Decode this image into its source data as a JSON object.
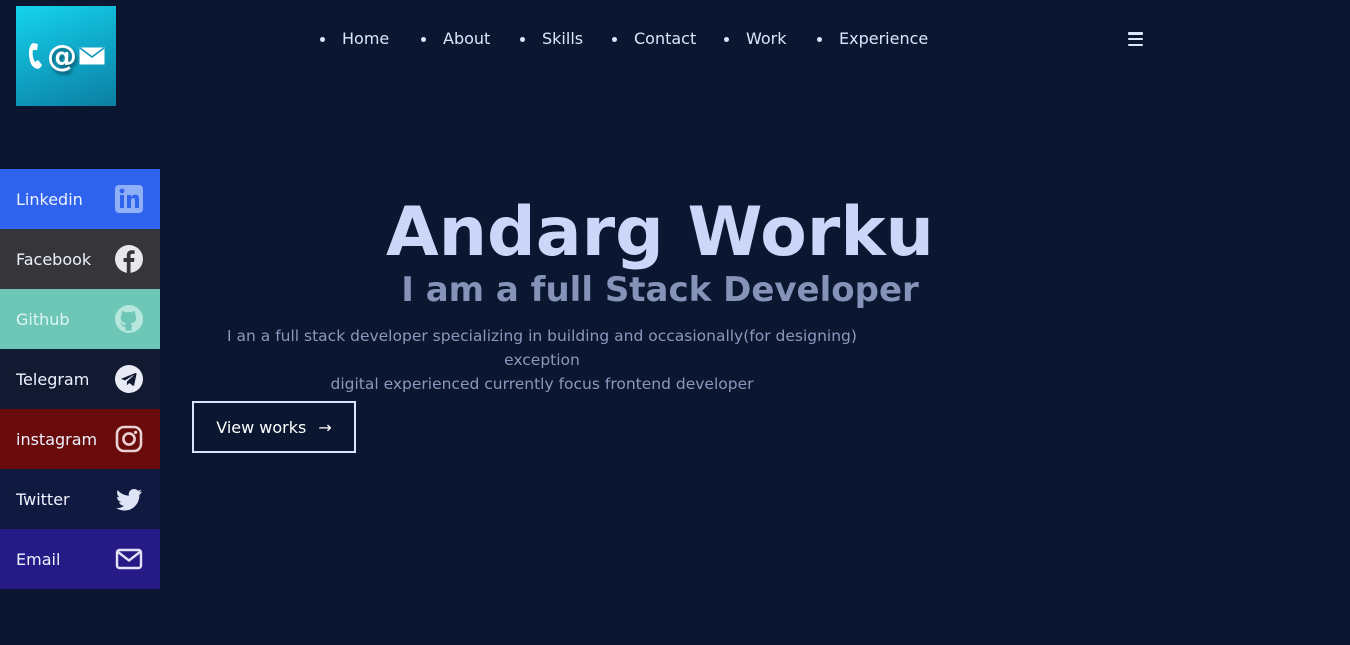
{
  "nav": {
    "items": [
      "Home",
      "About",
      "Skills",
      "Contact",
      "Work",
      "Experience"
    ],
    "menu_icon": "hamburger-menu-icon"
  },
  "logo": {
    "icons": [
      "phone-icon",
      "at-sign-icon",
      "envelope-icon"
    ],
    "at_glyph": "@"
  },
  "social": [
    {
      "label": "Linkedin",
      "icon": "linkedin-icon",
      "bg": "#2f63ee"
    },
    {
      "label": "Facebook",
      "icon": "facebook-icon",
      "bg": "#35353a"
    },
    {
      "label": "Github",
      "icon": "github-icon",
      "bg": "#6ec7b6"
    },
    {
      "label": "Telegram",
      "icon": "telegram-icon",
      "bg": "#111a30"
    },
    {
      "label": "instagram",
      "icon": "instagram-icon",
      "bg": "#6a0b0b"
    },
    {
      "label": "Twitter",
      "icon": "twitter-icon",
      "bg": "#101a40"
    },
    {
      "label": "Email",
      "icon": "email-icon",
      "bg": "#261b86"
    }
  ],
  "hero": {
    "name": "Andarg Worku",
    "subtitle": "I am a full Stack Developer",
    "description_line1": "I an a full stack developer specializing in building and occasionally(for designing) exception",
    "description_line2": "digital experienced currently focus frontend developer",
    "button_label": "View works",
    "button_arrow": "→"
  },
  "colors": {
    "background": "#0b1730",
    "text_light": "#dbe5ff",
    "hero_name": "#cdd6f9",
    "hero_sub": "#8593b8",
    "logo_gradient_start": "#15d4ee"
  }
}
